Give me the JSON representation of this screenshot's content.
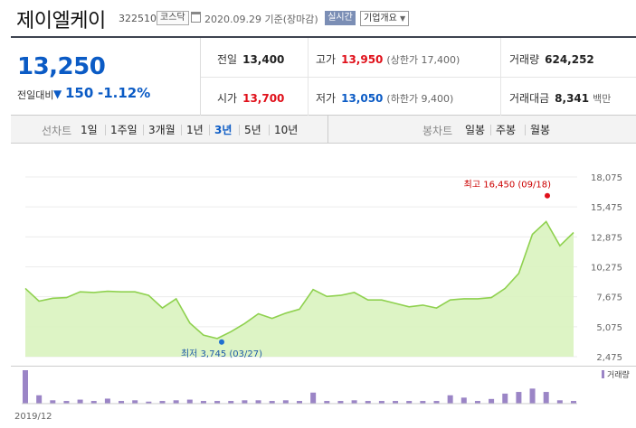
{
  "header": {
    "title": "제이엘케이",
    "code": "322510",
    "market_badge": "코스닥",
    "date": "2020.09.29 기준(장마감)",
    "realtime_badge": "실시간",
    "overview_label": "기업개요"
  },
  "price": {
    "now": "13,250",
    "diff_label": "전일대비",
    "diff_value": "150",
    "diff_rate": "-1.12%",
    "color": "#0b5bc5"
  },
  "stats": {
    "prev_close_label": "전일",
    "prev_close": "13,400",
    "high_label": "고가",
    "high": "13,950",
    "upper_limit": "(상한가 17,400)",
    "volume_label": "거래량",
    "volume": "624,252",
    "open_label": "시가",
    "open": "13,700",
    "low_label": "저가",
    "low": "13,050",
    "lower_limit": "(하한가 9,400)",
    "amount_label": "거래대금",
    "amount": "8,341",
    "amount_unit": "백만"
  },
  "periods": {
    "line_title": "선차트",
    "line_tabs": [
      "1일",
      "1주일",
      "3개월",
      "1년",
      "3년",
      "5년",
      "10년"
    ],
    "active": "3년",
    "candle_title": "봉차트",
    "candle_tabs": [
      "일봉",
      "주봉",
      "월봉"
    ]
  },
  "chart_data": {
    "type": "area",
    "title": "",
    "xlabel": "",
    "ylabel": "",
    "ylim": [
      2475,
      18075
    ],
    "y_ticks": [
      18075,
      15475,
      12875,
      10275,
      7675,
      5075,
      2475
    ],
    "y_tick_labels": [
      "18,075",
      "15,475",
      "12,875",
      "10,275",
      "7,675",
      "5,075",
      "2,475"
    ],
    "x_tick_labels": [
      "2019/12"
    ],
    "values": [
      8400,
      7300,
      7550,
      7600,
      8100,
      8050,
      8150,
      8100,
      8100,
      7800,
      6700,
      7500,
      5400,
      4350,
      4050,
      4650,
      5350,
      6200,
      5800,
      6250,
      6600,
      8300,
      7700,
      7800,
      8050,
      7400,
      7400,
      7100,
      6800,
      6950,
      6700,
      7400,
      7500,
      7500,
      7600,
      8400,
      9700,
      13100,
      14200,
      12100,
      13250
    ],
    "max_annotation": "최고 16,450 (09/18)",
    "max_value": 16450,
    "min_annotation": "최저 3,745 (03/27)",
    "min_value": 3745,
    "line_color": "#8fd14f",
    "fill_color": "#d9f3bf",
    "volume_label": "거래량",
    "volume_color": "#9b85c6",
    "volume": [
      100,
      25,
      10,
      8,
      12,
      8,
      15,
      8,
      10,
      6,
      8,
      10,
      12,
      8,
      8,
      8,
      10,
      10,
      8,
      10,
      8,
      33,
      8,
      8,
      10,
      8,
      8,
      8,
      8,
      8,
      8,
      25,
      18,
      8,
      14,
      30,
      35,
      45,
      35,
      10,
      8
    ]
  }
}
